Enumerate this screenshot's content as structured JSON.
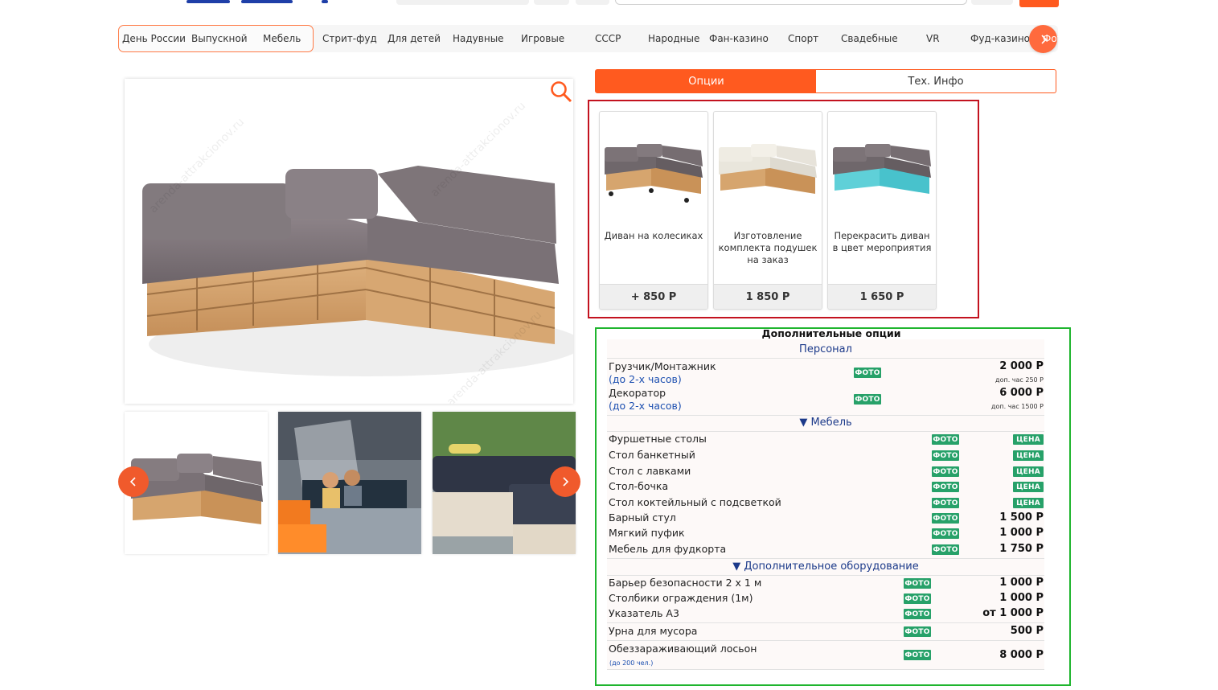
{
  "categories": [
    {
      "label": "День России",
      "active": true
    },
    {
      "label": "Выпускной",
      "active": true
    },
    {
      "label": "Мебель",
      "active": true
    },
    {
      "label": "Стрит-фуд"
    },
    {
      "label": "Для детей"
    },
    {
      "label": "Надувные"
    },
    {
      "label": "Игровые"
    },
    {
      "label": "СССР"
    },
    {
      "label": "Народные"
    },
    {
      "label": "Фан-казино"
    },
    {
      "label": "Спорт"
    },
    {
      "label": "Свадебные"
    },
    {
      "label": "VR"
    },
    {
      "label": "Фуд-казино"
    },
    {
      "label": "Фот"
    }
  ],
  "product": {
    "watermark": "arenda-attrakcionov.ru",
    "zoom_icon": "search-icon",
    "thumbs_prev_icon": "chevron-left-icon",
    "thumbs_next_icon": "chevron-right-icon"
  },
  "tabs": {
    "options": "Опции",
    "tech": "Тех. Инфо"
  },
  "options_cards": [
    {
      "title": "Диван на колесиках",
      "price": "+ 850 Р"
    },
    {
      "title": "Изготовление комплекта подушек на заказ",
      "price": "1 850 Р"
    },
    {
      "title": "Перекрасить диван в цвет мероприятия",
      "price": "1 650 Р"
    }
  ],
  "additional": {
    "title": "Дополнительные опции",
    "photo_label": "ФОТО",
    "price_label": "ЦЕНА",
    "sections": {
      "personnel": {
        "title": "Персонал",
        "rows": [
          {
            "name": "Грузчик/Монтажник",
            "sub": "(до 2-х часов)",
            "price": "2 000 Р",
            "note": "доп. час 250 Р"
          },
          {
            "name": "Декоратор",
            "sub": "(до 2-х часов)",
            "price": "6 000 Р",
            "note": "доп. час 1500 Р"
          }
        ]
      },
      "furniture": {
        "title": "▼ Мебель",
        "rows": [
          {
            "name": "Фуршетные столы",
            "price": "ЦЕНА"
          },
          {
            "name": "Стол банкетный",
            "price": "ЦЕНА"
          },
          {
            "name": "Стол с лавками",
            "price": "ЦЕНА"
          },
          {
            "name": "Стол-бочка",
            "price": "ЦЕНА"
          },
          {
            "name": "Стол коктейльный с подсветкой",
            "price": "ЦЕНА"
          },
          {
            "name": "Барный стул",
            "price": "1 500 Р"
          },
          {
            "name": "Мягкий пуфик",
            "price": "1 000 Р"
          },
          {
            "name": "Мебель для фудкорта",
            "price": "1 750 Р"
          }
        ]
      },
      "equipment": {
        "title": "▼ Дополнительное оборудование",
        "rows": [
          {
            "name": "Барьер безопасности 2 х 1 м",
            "price": "1 000 Р"
          },
          {
            "name": "Столбики ограждения (1м)",
            "price": "1 000 Р"
          },
          {
            "name": "Указатель А3",
            "price": "от 1 000 Р"
          },
          {
            "name": "Урна для мусора",
            "price": "500 Р"
          },
          {
            "name": "Обеззараживающий лосьон",
            "sub": "(до 200 чел.)",
            "price": "8 000 Р"
          }
        ]
      }
    }
  },
  "colors": {
    "accent": "#ff5a1f",
    "badge": "#27a169",
    "link": "#1c3a8a",
    "highlight_red": "#c3121f",
    "highlight_green": "#1fb52e"
  }
}
